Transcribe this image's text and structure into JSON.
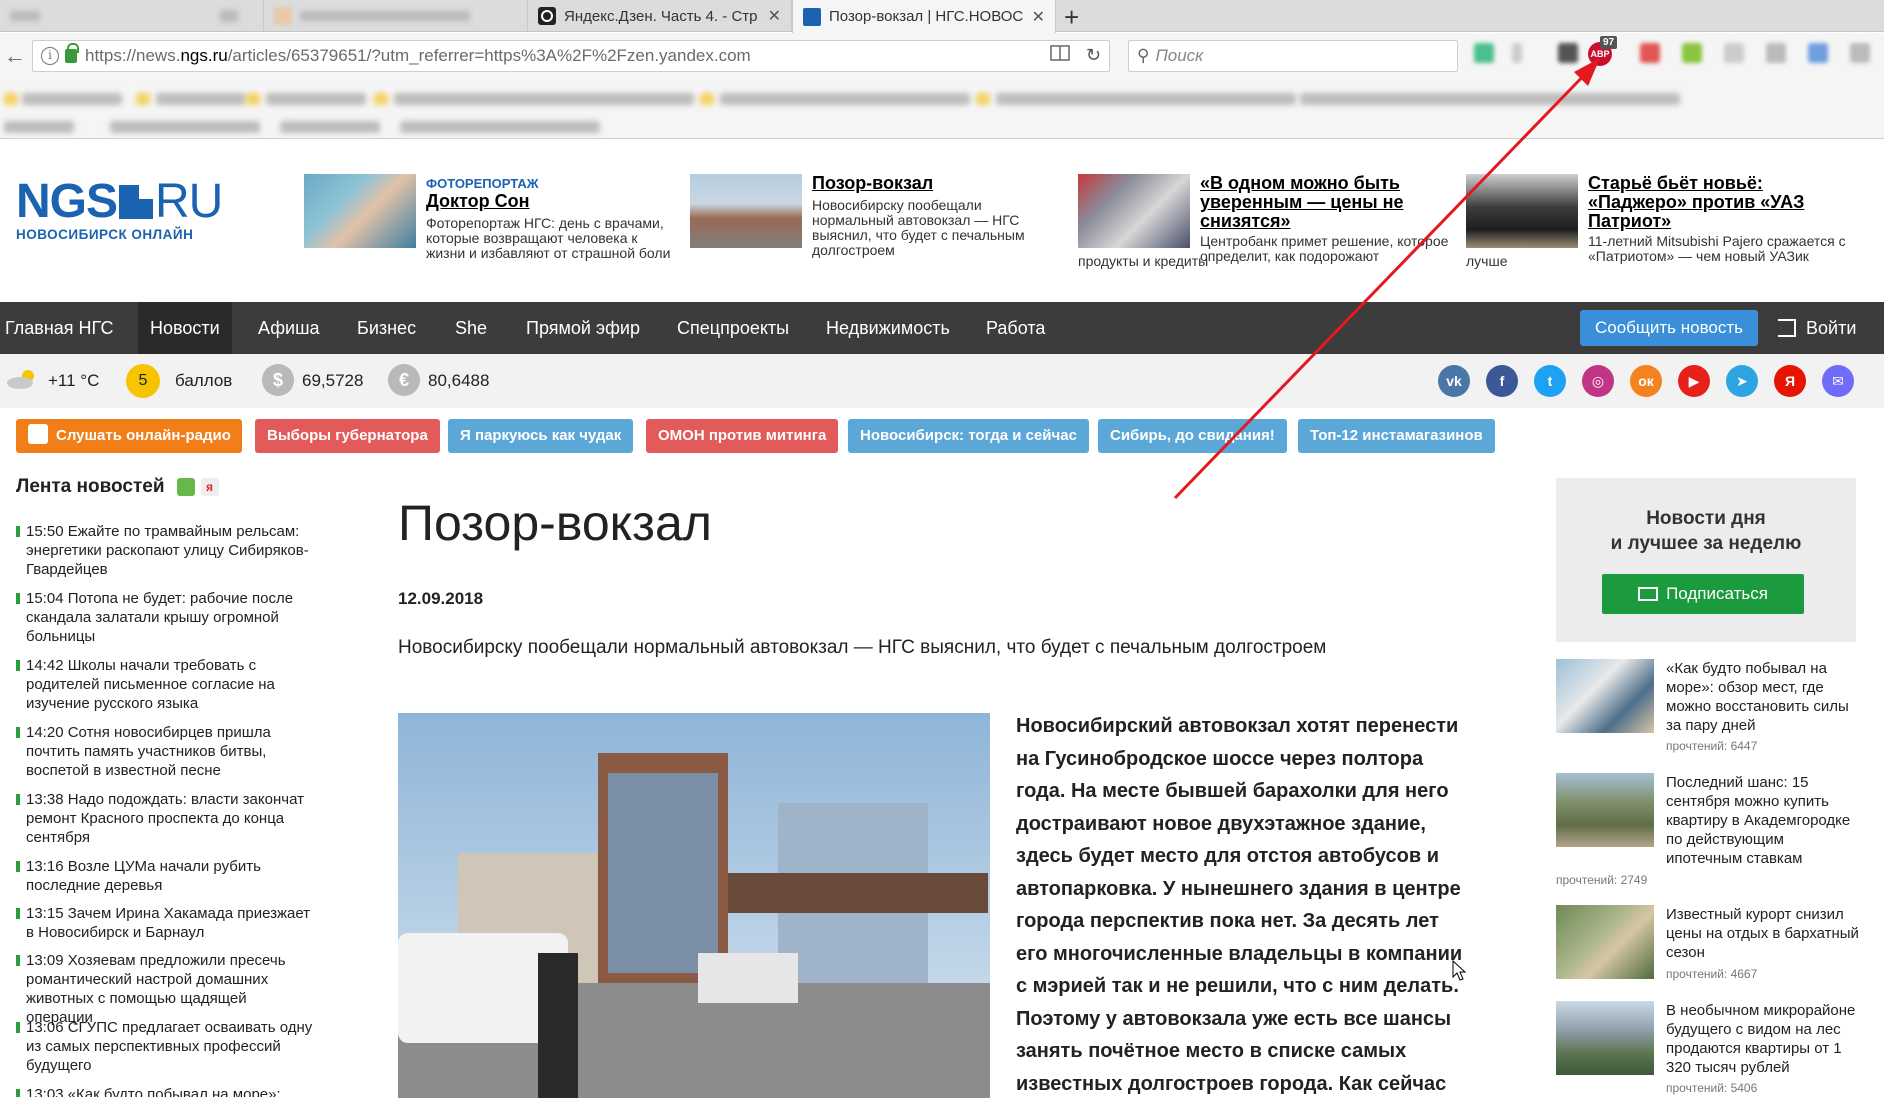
{
  "browser": {
    "tabs": [
      {
        "title": "",
        "blurred": true
      },
      {
        "title": "",
        "blurred": true
      },
      {
        "title": "Яндекс.Дзен. Часть 4. - Стр",
        "close": "✕"
      },
      {
        "title": "Позор-вокзал | НГС.НОВОС",
        "close": "✕"
      }
    ],
    "new_tab": "+",
    "url_prefix": "https://news.",
    "url_domain": "ngs.ru",
    "url_rest": "/articles/65379651/?utm_referrer=https%3A%2F%2Fzen.yandex.com",
    "search_placeholder": "Поиск",
    "adblock_label": "ABP",
    "adblock_badge": "97"
  },
  "site": {
    "logo_main": "NGS",
    "logo_ru": "RU",
    "logo_sub": "НОВОСИБИРСК ОНЛАЙН",
    "promos": [
      {
        "kicker": "ФОТОРЕПОРТАЖ",
        "title": "Доктор Сон",
        "text": "Фоторепортаж НГС: день с врачами, которые возвращают человека к жизни и избавляют от страшной боли"
      },
      {
        "title": "Позор-вокзал",
        "text": "Новосибирску пообещали нормальный автовокзал — НГС выяснил, что будет с печальным долгостроем"
      },
      {
        "title": "«В одном можно быть уверенным — цены не снизятся»",
        "text": "Центробанк примет решение, которое определит, как подорожают",
        "text_tail": "продукты и кредиты"
      },
      {
        "title": "Старьё бьёт новьё: «Паджеро» против «УАЗ Патриот»",
        "text": "11-летний Mitsubishi Pajero сражается с «Патриотом» — чем новый УАЗик",
        "text_tail": "лучше"
      }
    ],
    "nav": [
      "Главная НГС",
      "Новости",
      "Афиша",
      "Бизнес",
      "She",
      "Прямой эфир",
      "Спецпроекты",
      "Недвижимость",
      "Работа"
    ],
    "nav_active": "Новости",
    "report_button": "Сообщить новость",
    "login": "Войти",
    "weather": "+11 °C",
    "score": "5",
    "score_label": "баллов",
    "usd_icon": "$",
    "usd": "69,5728",
    "eur_icon": "€",
    "eur": "80,6488",
    "socials": [
      {
        "name": "vk",
        "glyph": "vk",
        "color": "#4a76a8"
      },
      {
        "name": "facebook",
        "glyph": "f",
        "color": "#3b5998"
      },
      {
        "name": "twitter",
        "glyph": "t",
        "color": "#1da1f2"
      },
      {
        "name": "instagram",
        "glyph": "◎",
        "color": "#c13584"
      },
      {
        "name": "odnoklassniki",
        "glyph": "ок",
        "color": "#f58220"
      },
      {
        "name": "youtube",
        "glyph": "▶",
        "color": "#e62117"
      },
      {
        "name": "telegram",
        "glyph": "➤",
        "color": "#2ca5e0"
      },
      {
        "name": "yandex",
        "glyph": "Я",
        "color": "#e61400"
      },
      {
        "name": "messenger",
        "glyph": "✉",
        "color": "#6f6cf7"
      }
    ],
    "tags": [
      {
        "label": "Слушать онлайн-радио",
        "color": "#f27e1a"
      },
      {
        "label": "Выборы губернатора",
        "color": "#e35a5a"
      },
      {
        "label": "Я паркуюсь как чудак",
        "color": "#5aa7d8"
      },
      {
        "label": "ОМОН против митинга",
        "color": "#e35a5a"
      },
      {
        "label": "Новосибирск: тогда и сейчас",
        "color": "#5aa7d8"
      },
      {
        "label": "Сибирь, до свидания!",
        "color": "#5aa7d8"
      },
      {
        "label": "Топ-12 инстамагазинов",
        "color": "#5aa7d8"
      }
    ]
  },
  "feed": {
    "title": "Лента новостей",
    "yandex_icon": "я",
    "items": [
      {
        "time": "15:50",
        "text": "Ежайте по трамвайным рельсам: энергетики раскопают улицу Сибиряков-Гвардейцев"
      },
      {
        "time": "15:04",
        "text": "Потопа не будет: рабочие после скандала залатали крышу огромной больницы"
      },
      {
        "time": "14:42",
        "text": "Школы начали требовать с родителей письменное согласие на изучение русского языка"
      },
      {
        "time": "14:20",
        "text": "Сотня новосибирцев пришла почтить память участников битвы, воспетой в известной песне"
      },
      {
        "time": "13:38",
        "text": "Надо подождать: власти закончат ремонт Красного проспекта до конца сентября"
      },
      {
        "time": "13:16",
        "text": "Возле ЦУМа начали рубить последние деревья"
      },
      {
        "time": "13:15",
        "text": "Зачем Ирина Хакамада приезжает в Новосибирск и Барнаул"
      },
      {
        "time": "13:09",
        "text": "Хозяевам предложили пресечь романтический настрой домашних животных с помощью щадящей операции"
      },
      {
        "time": "13:06",
        "text": "СГУПС предлагает осваивать одну из самых перспективных профессий будущего"
      },
      {
        "time": "13:03",
        "text": "«Как будто побывал на море»:"
      }
    ]
  },
  "article": {
    "title": "Позор-вокзал",
    "date": "12.09.2018",
    "lead": "Новосибирску пообещали нормальный автовокзал — НГС выяснил, что будет с печальным долгостроем",
    "body": "Новосибирский автовокзал хотят перенести на Гусинобродское шоссе через полтора года. На месте бывшей барахолки для него достраивают новое двухэтажное здание, здесь будет место для отстоя автобусов и автопарковка. У нынешнего здания в центре города перспектив пока нет. За десять лет его многочисленные владельцы в компании с мэрией так и не решили, что с ним делать. Поэтому у автовокзала уже есть все шансы занять почётное место в списке самых известных долгостроев города. Как сейчас"
  },
  "sidebar": {
    "box_title_1": "Новости дня",
    "box_title_2": "и лучшее за неделю",
    "subscribe_label": "Подписаться",
    "news": [
      {
        "text": "«Как будто побывал на море»: обзор мест, где можно восстановить силы за пару дней",
        "views": "прочтений: 6447"
      },
      {
        "text": "Последний шанс: 15 сентября можно купить квартиру в Академгородке по действующим ипотечным ставкам",
        "views": "прочтений: 2749"
      },
      {
        "text": "Известный курорт снизил цены на отдых в бархатный сезон",
        "views": "прочтений: 4667"
      },
      {
        "text": "В необычном микрорайоне будущего с видом на лес продаются квартиры от 1 320 тысяч рублей",
        "views": "прочтений: 5406"
      }
    ]
  }
}
